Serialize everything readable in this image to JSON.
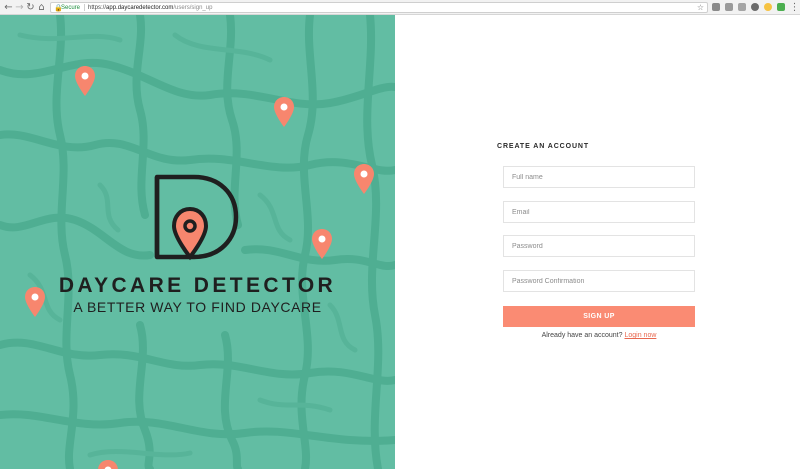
{
  "browser": {
    "back_icon": "arrow-left",
    "forward_icon": "arrow-right",
    "reload_icon": "reload",
    "home_icon": "home",
    "secure_label": "Secure",
    "url_scheme": "https://",
    "url_host": "app.daycaredetector.com",
    "url_path": "/users/sign_up",
    "bookmark_icon": "star",
    "extension_colors": [
      "#8a8a8a",
      "#9a9a9a",
      "#a5a5a5",
      "#6b6b6b",
      "#f6c342",
      "#4caf50"
    ]
  },
  "hero": {
    "background_color": "#62bda3",
    "road_color": "#4fae92",
    "pin_color": "#f7866e",
    "brand_name": "DAYCARE DETECTOR",
    "tagline": "A BETTER WAY TO FIND DAYCARE"
  },
  "form": {
    "title": "CREATE AN ACCOUNT",
    "full_name_placeholder": "Full name",
    "email_placeholder": "Email",
    "password_placeholder": "Password",
    "password_confirmation_placeholder": "Password Confirmation",
    "signup_label": "SIGN UP",
    "login_prompt": "Already have an account?",
    "login_link": "Login now",
    "accent_color": "#fa8b73"
  }
}
